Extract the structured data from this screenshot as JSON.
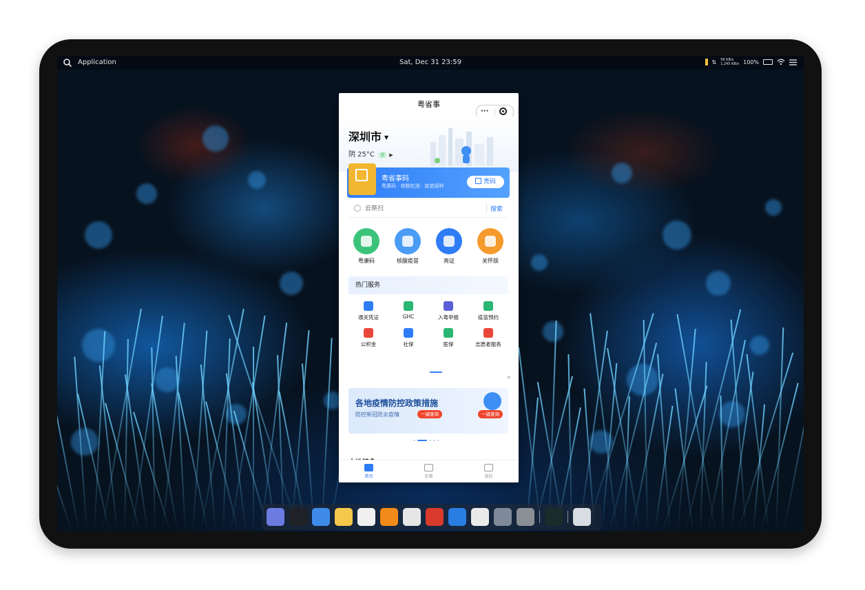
{
  "menubar": {
    "app_label": "Application",
    "clock": "Sat, Dec 31   23:59",
    "battery": "100%",
    "net_up": "56 KB/s",
    "net_down": "1,245 KB/s"
  },
  "miniapp": {
    "title": "粤省事",
    "city": "深圳市",
    "weather": "阴 25°C",
    "air_quality": "优",
    "code_banner": {
      "title": "粤省事码",
      "subtitle": "粤康码 · 核酸检测 · 疫苗接种",
      "button": "亮码"
    },
    "search": {
      "placeholder": "云祭扫",
      "button": "搜索"
    },
    "quick_items": [
      {
        "label": "粤康码",
        "color": "#3cc37a"
      },
      {
        "label": "核酸疫苗",
        "color": "#4a9cf5"
      },
      {
        "label": "亮证",
        "color": "#2f7df6"
      },
      {
        "label": "关怀版",
        "color": "#f59a2c"
      }
    ],
    "hot_services": {
      "title": "热门服务",
      "items": [
        {
          "label": "通关凭证",
          "color": "#2f7df6"
        },
        {
          "label": "GHC",
          "color": "#2bb673"
        },
        {
          "label": "入粤申报",
          "color": "#5b5fd6"
        },
        {
          "label": "疫苗预约",
          "color": "#2bb673"
        },
        {
          "label": "公积金",
          "color": "#e8483a"
        },
        {
          "label": "社保",
          "color": "#2f7df6"
        },
        {
          "label": "医保",
          "color": "#2bb673"
        },
        {
          "label": "志愿者服务",
          "color": "#e8483a"
        }
      ]
    },
    "promo": {
      "title": "各地疫情防控政策措施",
      "subtitle": "防控新冠防炎疫情",
      "button": "一键查询",
      "button2": "一键查询"
    },
    "section_peek": "本地特色",
    "tabs": [
      {
        "label": "首页",
        "active": true
      },
      {
        "label": "办事",
        "active": false
      },
      {
        "label": "我的",
        "active": false
      }
    ]
  },
  "dock": {
    "apps": [
      {
        "name": "finder",
        "color": "#6c7be0"
      },
      {
        "name": "terminal",
        "color": "#1f2126"
      },
      {
        "name": "chrome",
        "color": "#3e8ce8"
      },
      {
        "name": "sketch",
        "color": "#f5c74b"
      },
      {
        "name": "dictionary",
        "color": "#f0f0f0"
      },
      {
        "name": "sublime-text",
        "color": "#f28a1a"
      },
      {
        "name": "typora",
        "color": "#e6e6e6"
      },
      {
        "name": "filezilla",
        "color": "#d93a2c"
      },
      {
        "name": "video-player",
        "color": "#2a7de1"
      },
      {
        "name": "github",
        "color": "#eaeaea"
      },
      {
        "name": "settings-app",
        "color": "#7e8a99"
      },
      {
        "name": "system-preferences",
        "color": "#8a8f96"
      },
      {
        "name": "activity-monitor",
        "color": "#1b2a2a"
      },
      {
        "name": "trash",
        "color": "#d8dde3"
      }
    ]
  }
}
